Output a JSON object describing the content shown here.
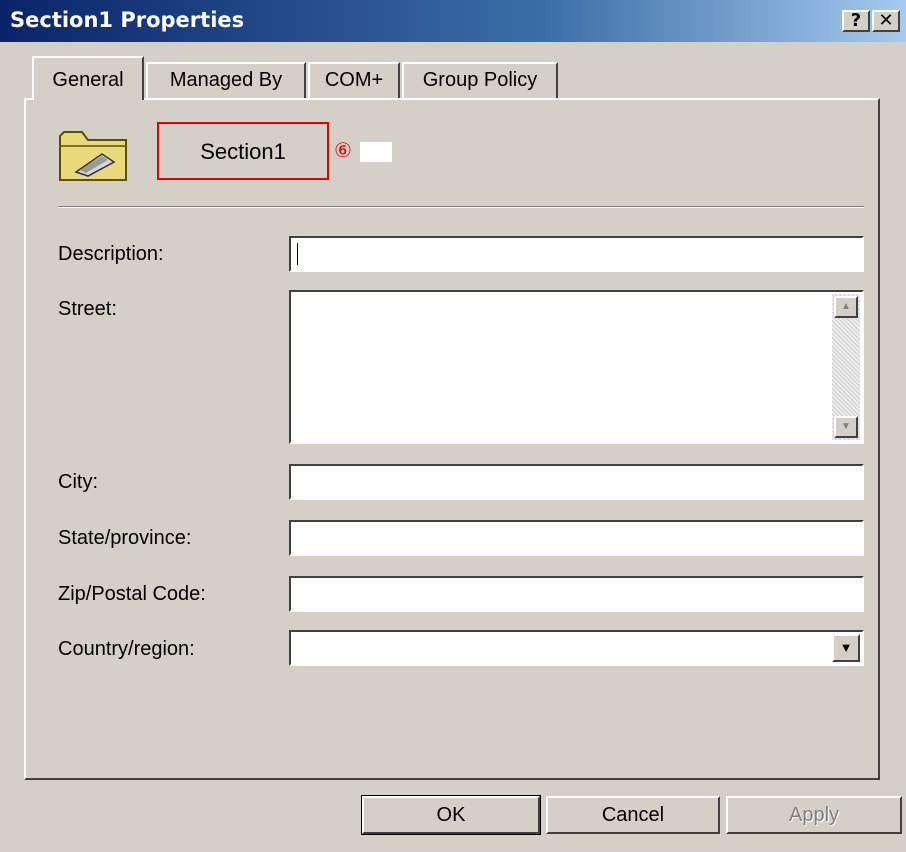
{
  "window": {
    "title": "Section1 Properties",
    "help_label": "?",
    "close_label": "✕"
  },
  "tabs": [
    {
      "label": "General",
      "active": true
    },
    {
      "label": "Managed By",
      "active": false
    },
    {
      "label": "COM+",
      "active": false
    },
    {
      "label": "Group Policy",
      "active": false
    }
  ],
  "general": {
    "object_icon": "folder-icon",
    "object_name": "Section1",
    "annotation_marker": "⑥",
    "fields": {
      "description": {
        "label": "Description:",
        "value": ""
      },
      "street": {
        "label": "Street:",
        "value": ""
      },
      "city": {
        "label": "City:",
        "value": ""
      },
      "state": {
        "label": "State/province:",
        "value": ""
      },
      "zip": {
        "label": "Zip/Postal Code:",
        "value": ""
      },
      "country": {
        "label": "Country/region:",
        "value": ""
      }
    }
  },
  "buttons": {
    "ok": "OK",
    "cancel": "Cancel",
    "apply": "Apply"
  },
  "colors": {
    "title_bar_start": "#0a246a",
    "title_bar_end": "#a6caf0",
    "dialog_face": "#d4d0c8",
    "highlight_box": "#e80000"
  }
}
